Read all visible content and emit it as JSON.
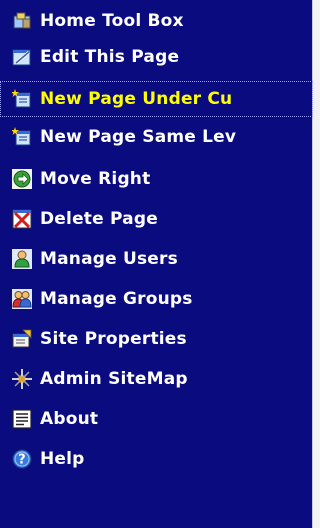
{
  "menu": {
    "items": [
      {
        "label": "Home Tool Box",
        "icon": "toolbox-icon"
      },
      {
        "label": "Edit This Page",
        "icon": "edit-page-icon"
      },
      {
        "label": "New Page Under Cu",
        "icon": "new-page-under-icon",
        "active": true
      },
      {
        "label": "New Page Same Lev",
        "icon": "new-page-same-level-icon"
      },
      {
        "label": "Move Right",
        "icon": "move-right-icon"
      },
      {
        "label": "Delete Page",
        "icon": "delete-page-icon"
      },
      {
        "label": "Manage Users",
        "icon": "user-icon"
      },
      {
        "label": "Manage Groups",
        "icon": "group-icon"
      },
      {
        "label": "Site Properties",
        "icon": "site-properties-icon"
      },
      {
        "label": "Admin SiteMap",
        "icon": "sitemap-icon"
      },
      {
        "label": "About",
        "icon": "about-document-icon"
      },
      {
        "label": "Help",
        "icon": "help-icon"
      }
    ],
    "colors": {
      "background": "#0b0b80",
      "text": "#ffffff",
      "active_text": "#ffff00"
    }
  }
}
